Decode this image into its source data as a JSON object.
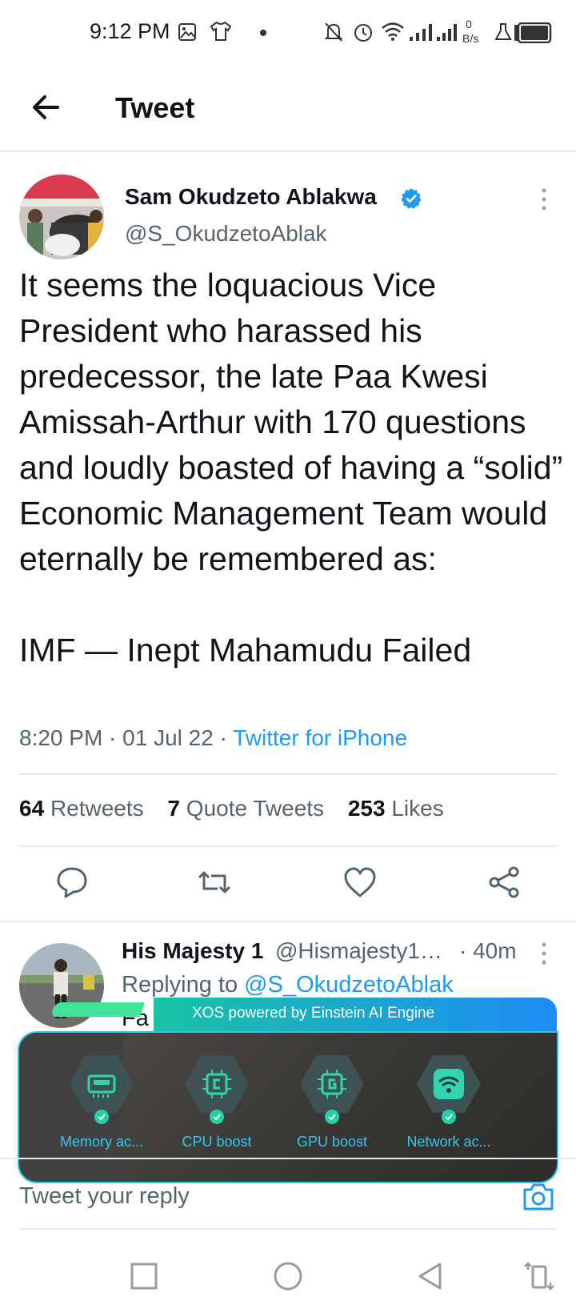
{
  "status_bar": {
    "time": "9:12 PM",
    "net_speed_value": "0",
    "net_speed_unit": "B/s",
    "icons": [
      "gallery-icon",
      "tshirt-icon",
      "dot-icon",
      "mute-icon",
      "alarm-icon",
      "wifi-icon",
      "signal-icon",
      "signal-icon",
      "lab-icon",
      "battery-icon"
    ]
  },
  "header": {
    "title": "Tweet"
  },
  "tweet": {
    "author_name": "Sam Okudzeto Ablakwa",
    "handle": "@S_OkudzetoAblak",
    "text": "It seems the loquacious Vice President who harassed his predecessor, the late Paa Kwesi Amissah-Arthur with 170 questions and loudly boasted of having a “solid” Economic Management Team would eternally be remembered as:\n\nIMF — Inept Mahamudu Failed",
    "time": "8:20 PM",
    "date": "01 Jul 22",
    "source": "Twitter for iPhone",
    "separator": " · ",
    "stats": {
      "retweets_count": "64",
      "retweets_label": "Retweets",
      "quotes_count": "7",
      "quotes_label": "Quote Tweets",
      "likes_count": "253",
      "likes_label": "Likes"
    }
  },
  "reply": {
    "author_name": "His Majesty 1",
    "handle": "@Hismajesty1…",
    "time": "· 40m",
    "replying_prefix": "Replying to",
    "replying_to": "@S_OkudzetoAblak",
    "text_fragment": "Fa"
  },
  "xos_overlay": {
    "banner": "XOS powered by Einstein AI Engine",
    "items": [
      {
        "label": "Memory ac...",
        "icon": "memory-icon"
      },
      {
        "label": "CPU boost",
        "icon": "cpu-icon"
      },
      {
        "label": "GPU boost",
        "icon": "gpu-icon"
      },
      {
        "label": "Network ac...",
        "icon": "wifi-icon"
      }
    ]
  },
  "composer": {
    "placeholder": "Tweet your reply"
  },
  "colors": {
    "accent": "#1d9bf0",
    "secondary_text": "#536471",
    "xos_teal": "#33c8ef",
    "xos_green": "#23d0a4"
  }
}
